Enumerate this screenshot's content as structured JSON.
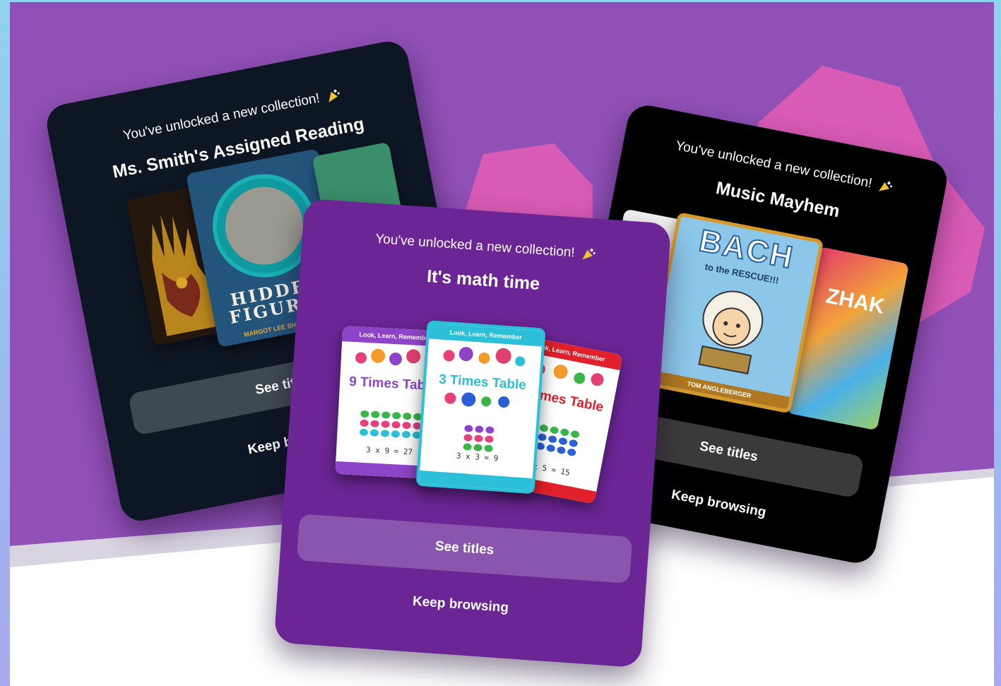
{
  "cards": {
    "reading": {
      "unlock_text": "You've unlocked a new collection!",
      "title": "Ms. Smith's Assigned Reading",
      "see_titles": "See titles",
      "keep_browsing": "Keep browsing",
      "book_cover_text": [
        "HIDDEN",
        "FIGURES"
      ],
      "book_author": "MARGOT LEE SHETTERLY"
    },
    "math": {
      "unlock_text": "You've unlocked a new collection!",
      "title": "It's math time",
      "see_titles": "See titles",
      "keep_browsing": "Keep browsing",
      "books": [
        {
          "band": "Look, Learn, Remember",
          "title": "9 Times Table",
          "equation": "3 x 9 = 27",
          "color": "#8e44c8"
        },
        {
          "band": "Look, Learn, Remember",
          "title": "3 Times Table",
          "equation": "3 x 3 = 9",
          "color": "#2cc0d8"
        },
        {
          "band": "Look, Learn, Remember",
          "title": "5 Times Table",
          "equation": "3 x 5 = 15",
          "color": "#e0202a"
        }
      ]
    },
    "music": {
      "unlock_text": "You've unlocked a new collection!",
      "title": "Music Mayhem",
      "see_titles": "See titles",
      "keep_browsing": "Keep browsing",
      "book_title": "BACH",
      "book_subtitle": "to the RESCUE!!!",
      "book_author": "TOM ANGLEBERGER",
      "right_book_title": "ZHAK"
    }
  },
  "colors": {
    "background_purple": "#9150b6",
    "blob_pink": "#d85bb5",
    "reading_card": "#0d1724",
    "math_card": "#6b2594",
    "music_card": "#000000"
  },
  "icons": {
    "celebration": "party-popper-icon"
  }
}
